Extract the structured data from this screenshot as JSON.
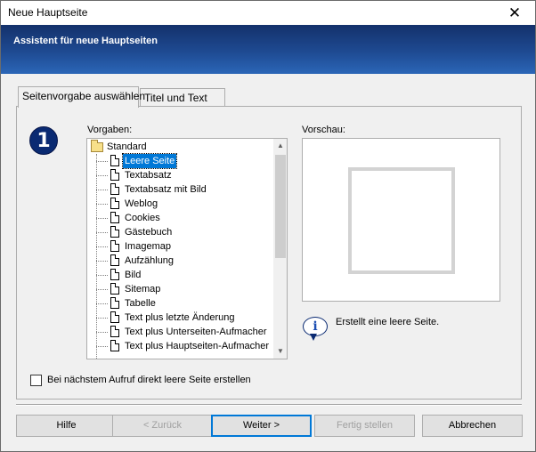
{
  "window": {
    "title": "Neue Hauptseite"
  },
  "banner": {
    "heading": "Assistent für neue Hauptseiten"
  },
  "tabs": [
    {
      "label": "Seitenvorgabe auswählen",
      "active": true
    },
    {
      "label": "Titel und Text",
      "active": false
    }
  ],
  "step": {
    "number": "1"
  },
  "vorgaben": {
    "label": "Vorgaben:",
    "folder": "Standard",
    "items": [
      "Leere Seite",
      "Textabsatz",
      "Textabsatz mit Bild",
      "Weblog",
      "Cookies",
      "Gästebuch",
      "Imagemap",
      "Aufzählung",
      "Bild",
      "Sitemap",
      "Tabelle",
      "Text plus letzte Änderung",
      "Text plus Unterseiten-Aufmacher",
      "Text plus Hauptseiten-Aufmacher"
    ],
    "selected": "Leere Seite"
  },
  "vorschau": {
    "label": "Vorschau:"
  },
  "info": {
    "text": "Erstellt eine leere Seite."
  },
  "checkbox": {
    "label": "Bei nächstem Aufruf direkt leere Seite erstellen",
    "checked": false
  },
  "buttons": {
    "help": "Hilfe",
    "back": "< Zurück",
    "next": "Weiter >",
    "finish": "Fertig stellen",
    "cancel": "Abbrechen"
  },
  "colors": {
    "banner_top": "#14316b",
    "banner_bottom": "#2b66b7",
    "selection": "#0078d7"
  },
  "icons": {
    "close": "close-icon",
    "step": "step-one-icon",
    "info": "info-icon",
    "folder": "folder-icon",
    "document": "document-icon"
  }
}
